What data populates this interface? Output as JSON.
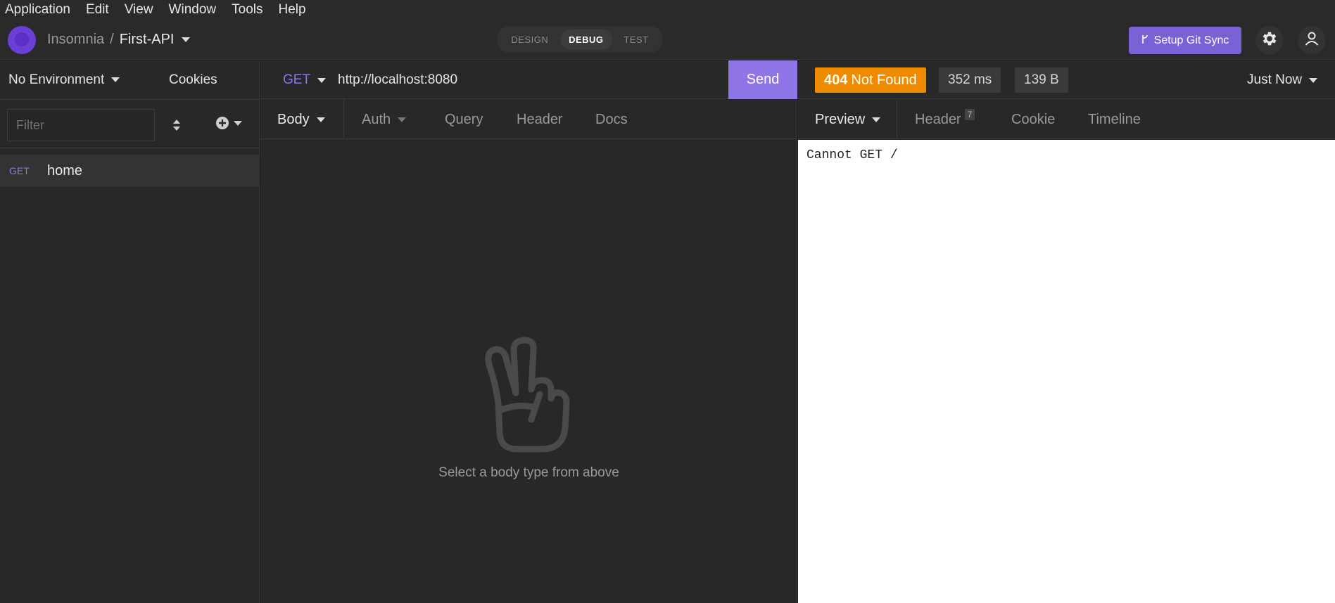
{
  "menu": [
    "Application",
    "Edit",
    "View",
    "Window",
    "Tools",
    "Help"
  ],
  "header": {
    "org": "Insomnia",
    "separator": "/",
    "project": "First-API",
    "modes": [
      "DESIGN",
      "DEBUG",
      "TEST"
    ],
    "active_mode": "DEBUG",
    "git_sync_label": "Setup Git Sync"
  },
  "sidebar": {
    "environment": "No Environment",
    "cookies_label": "Cookies",
    "filter_placeholder": "Filter",
    "requests": [
      {
        "method": "GET",
        "name": "home"
      }
    ]
  },
  "request": {
    "method": "GET",
    "url": "http://localhost:8080",
    "send_label": "Send",
    "tabs": [
      "Body",
      "Auth",
      "Query",
      "Header",
      "Docs"
    ],
    "empty_message": "Select a body type from above"
  },
  "response": {
    "status_code": "404",
    "status_text": "Not Found",
    "time": "352 ms",
    "size": "139 B",
    "timestamp": "Just Now",
    "tabs": [
      "Preview",
      "Header",
      "Cookie",
      "Timeline"
    ],
    "header_count": "7",
    "body": "Cannot GET /"
  },
  "colors": {
    "accent": "#8f75e6",
    "status_warning": "#ef8b00",
    "git_sync": "#7b61d6"
  }
}
